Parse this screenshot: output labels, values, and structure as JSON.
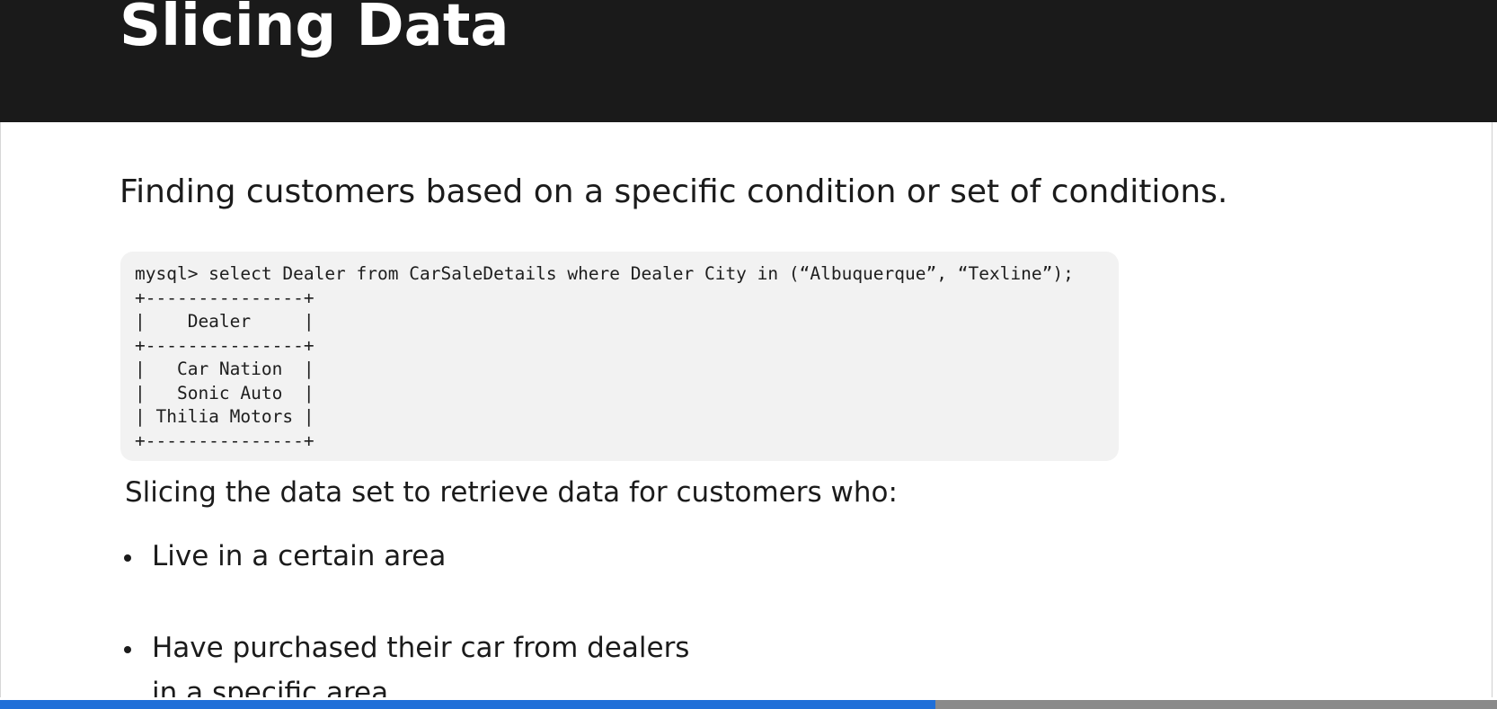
{
  "slide": {
    "title": "Slicing Data",
    "intro": "Finding customers based on a specific condition or set of conditions.",
    "code_lines": [
      "mysql> select Dealer from CarSaleDetails where Dealer City in (“Albuquerque”, “Texline”);",
      "+---------------+",
      "|    Dealer     |",
      "+---------------+",
      "|   Car Nation  |",
      "|   Sonic Auto  |",
      "| Thilia Motors |",
      "+---------------+"
    ],
    "lead": "Slicing the data set to retrieve data for customers who:",
    "bullets": [
      "Live in a certain area",
      "Have purchased their car from dealers",
      "in a specific area"
    ]
  },
  "video": {
    "progress_fraction": 0.625,
    "progress_color": "#1f6fd8",
    "header_color": "#1a1a1a"
  }
}
